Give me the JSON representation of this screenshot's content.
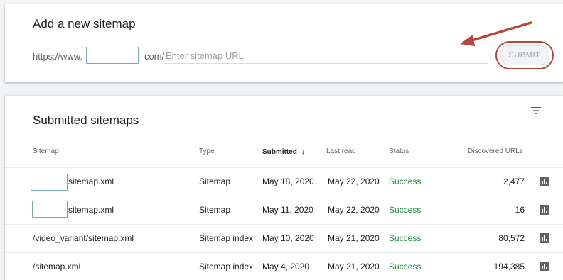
{
  "add_sitemap": {
    "title": "Add a new sitemap",
    "url_prefix": "https://www.",
    "url_suffix": "com/",
    "input_placeholder": "Enter sitemap URL",
    "input_value": "",
    "submit_label": "SUBMIT"
  },
  "submitted": {
    "title": "Submitted sitemaps",
    "columns": {
      "sitemap": "Sitemap",
      "type": "Type",
      "submitted": "Submitted",
      "sort_arrow": "↓",
      "last_read": "Last read",
      "status": "Status",
      "discovered": "Discovered URLs"
    },
    "rows": [
      {
        "sitemap": "sitemap.xml",
        "type": "Sitemap",
        "submitted": "May 18, 2020",
        "last_read": "May 22, 2020",
        "status": "Success",
        "discovered": "2,477"
      },
      {
        "sitemap": "sitemap.xml",
        "type": "Sitemap",
        "submitted": "May 11, 2020",
        "last_read": "May 22, 2020",
        "status": "Success",
        "discovered": "16"
      },
      {
        "sitemap": "/video_variant/sitemap.xml",
        "type": "Sitemap index",
        "submitted": "May 10, 2020",
        "last_read": "May 21, 2020",
        "status": "Success",
        "discovered": "80,572"
      },
      {
        "sitemap": "/sitemap.xml",
        "type": "Sitemap index",
        "submitted": "May 4, 2020",
        "last_read": "May 21, 2020",
        "status": "Success",
        "discovered": "194,385"
      }
    ]
  },
  "icons": {
    "filter": "filter-icon",
    "row_chart": "bar-chart-icon",
    "annotation_arrow": "red-arrow-icon"
  },
  "colors": {
    "success": "#1e8e3e",
    "annotation": "#b5473a",
    "redaction_border": "#7aa6a8"
  }
}
